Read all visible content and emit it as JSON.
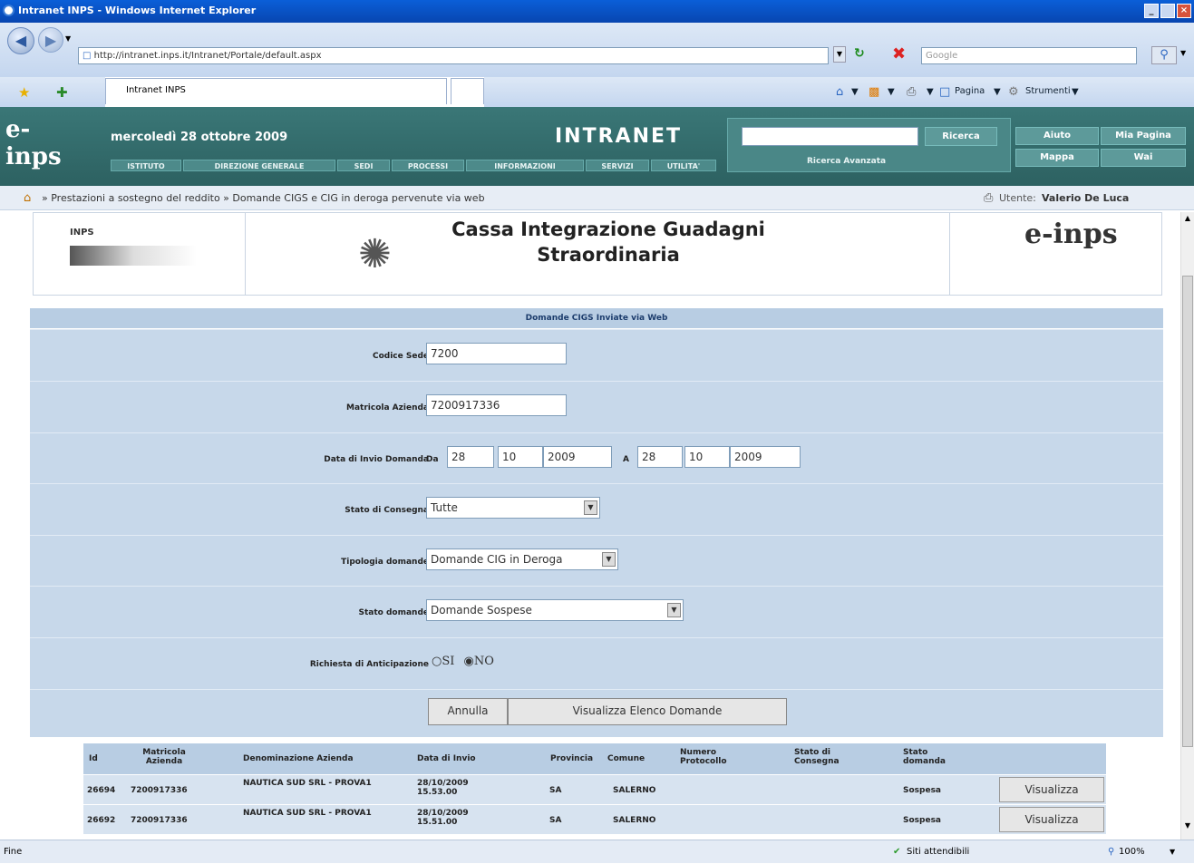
{
  "window": {
    "title": "Intranet INPS - Windows Internet Explorer",
    "min": "_",
    "max": "×"
  },
  "browser": {
    "address": "http://intranet.inps.it/Intranet/Portale/default.aspx",
    "search_placeholder": "Google",
    "tab_label": "Intranet INPS",
    "page_menu": "Pagina",
    "tools_menu": "Strumenti"
  },
  "site": {
    "logo": "e-inps",
    "date": "mercoledì 28 ottobre 2009",
    "brand": "INTRANET",
    "nav": [
      "ISTITUTO",
      "DIREZIONE GENERALE",
      "SEDI",
      "PROCESSI",
      "INFORMAZIONI",
      "SERVIZI",
      "UTILITA'"
    ],
    "search_button": "Ricerca",
    "advanced_search": "Ricerca Avanzata",
    "help": "Aiuto",
    "my_page": "Mia Pagina",
    "map": "Mappa",
    "wai": "Wai"
  },
  "breadcrumb": {
    "text": "» Prestazioni a sostegno del reddito » Domande CIGS e CIG in deroga pervenute via web"
  },
  "user": {
    "label": "Utente:",
    "name": "Valerio De Luca"
  },
  "banner": {
    "title_line1": "Cassa Integrazione Guadagni",
    "title_line2": "Straordinaria",
    "left_logo": "INPS",
    "right_logo": "e-inps"
  },
  "form": {
    "header": "Domande CIGS Inviate via Web",
    "codice_sede": {
      "label": "Codice Sede",
      "value": "7200"
    },
    "matricola": {
      "label": "Matricola Azienda",
      "value": "7200917336"
    },
    "data_invio": {
      "label": "Data di Invio Domanda",
      "da": "Da",
      "a": "A",
      "from_day": "28",
      "from_month": "10",
      "from_year": "2009",
      "to_day": "28",
      "to_month": "10",
      "to_year": "2009"
    },
    "stato_consegna": {
      "label": "Stato di Consegna",
      "value": "Tutte"
    },
    "tipologia": {
      "label": "Tipologia domande",
      "value": "Domande CIG in Deroga"
    },
    "stato_domande": {
      "label": "Stato domande",
      "value": "Domande Sospese"
    },
    "anticipazione": {
      "label": "Richiesta di Anticipazione",
      "si": "SI",
      "no": "NO",
      "selected": "NO"
    },
    "annulla": "Annulla",
    "visualizza_elenco": "Visualizza Elenco Domande"
  },
  "table": {
    "headers": {
      "id": "Id",
      "matricola": "Matricola Azienda",
      "denominazione": "Denominazione Azienda",
      "data": "Data di Invio",
      "provincia": "Provincia",
      "comune": "Comune",
      "protocollo": "Numero Protocollo",
      "consegna": "Stato di Consegna",
      "stato": "Stato domanda"
    },
    "rows": [
      {
        "id": "26694",
        "matricola": "7200917336",
        "denominazione": "NAUTICA SUD SRL - PROVA1",
        "data": "28/10/2009 15.53.00",
        "provincia": "SA",
        "comune": "SALERNO",
        "stato": "Sospesa",
        "button": "Visualizza"
      },
      {
        "id": "26692",
        "matricola": "7200917336",
        "denominazione": "NAUTICA SUD SRL - PROVA1",
        "data": "28/10/2009 15.51.00",
        "provincia": "SA",
        "comune": "SALERNO",
        "stato": "Sospesa",
        "button": "Visualizza"
      }
    ]
  },
  "status": {
    "left": "Fine",
    "zone": "Siti attendibili",
    "zoom": "100%"
  }
}
